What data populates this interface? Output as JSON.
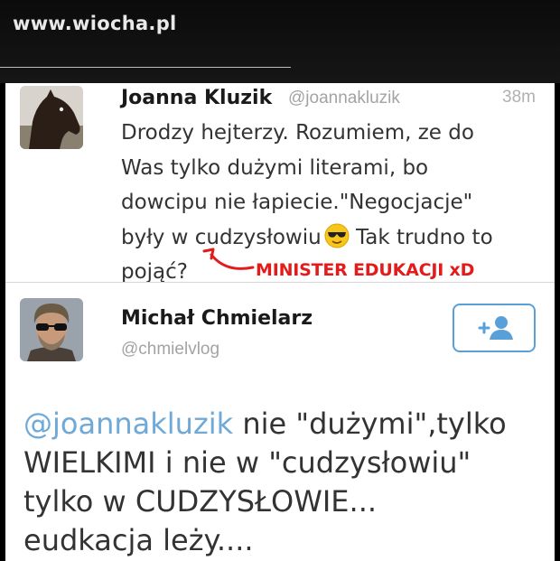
{
  "site": {
    "watermark": "www.wiocha.pl"
  },
  "tweet1": {
    "name": "Joanna Kluzik",
    "handle": "@joannakluzik",
    "time": "38m",
    "line1": "Drodzy hejterzy. Rozumiem, ze do",
    "line2": "Was tylko dużymi literami, bo",
    "line3": "dowcipu nie łapiecie.\"Negocjacje\"",
    "line4a": "były w cudzysłowiu",
    "line4b": " Tak trudno to",
    "line5": "pojąć?",
    "annotation": "MINISTER EDUKACJI xD",
    "annotation_color": "#e31b1b"
  },
  "tweet2": {
    "name": "Michał Chmielarz",
    "handle": "@chmielvlog",
    "follow_icon": "add-user-icon",
    "mention": "@joannakluzik",
    "line1_rest": " nie \"dużymi\",tylko",
    "line2": "WIELKIMI i nie w \"cudzysłowiu\"",
    "line3": "tylko w CUDZYSŁOWIE...",
    "line4": "eudkacja leży....",
    "mention_color": "#6fa9d8"
  }
}
